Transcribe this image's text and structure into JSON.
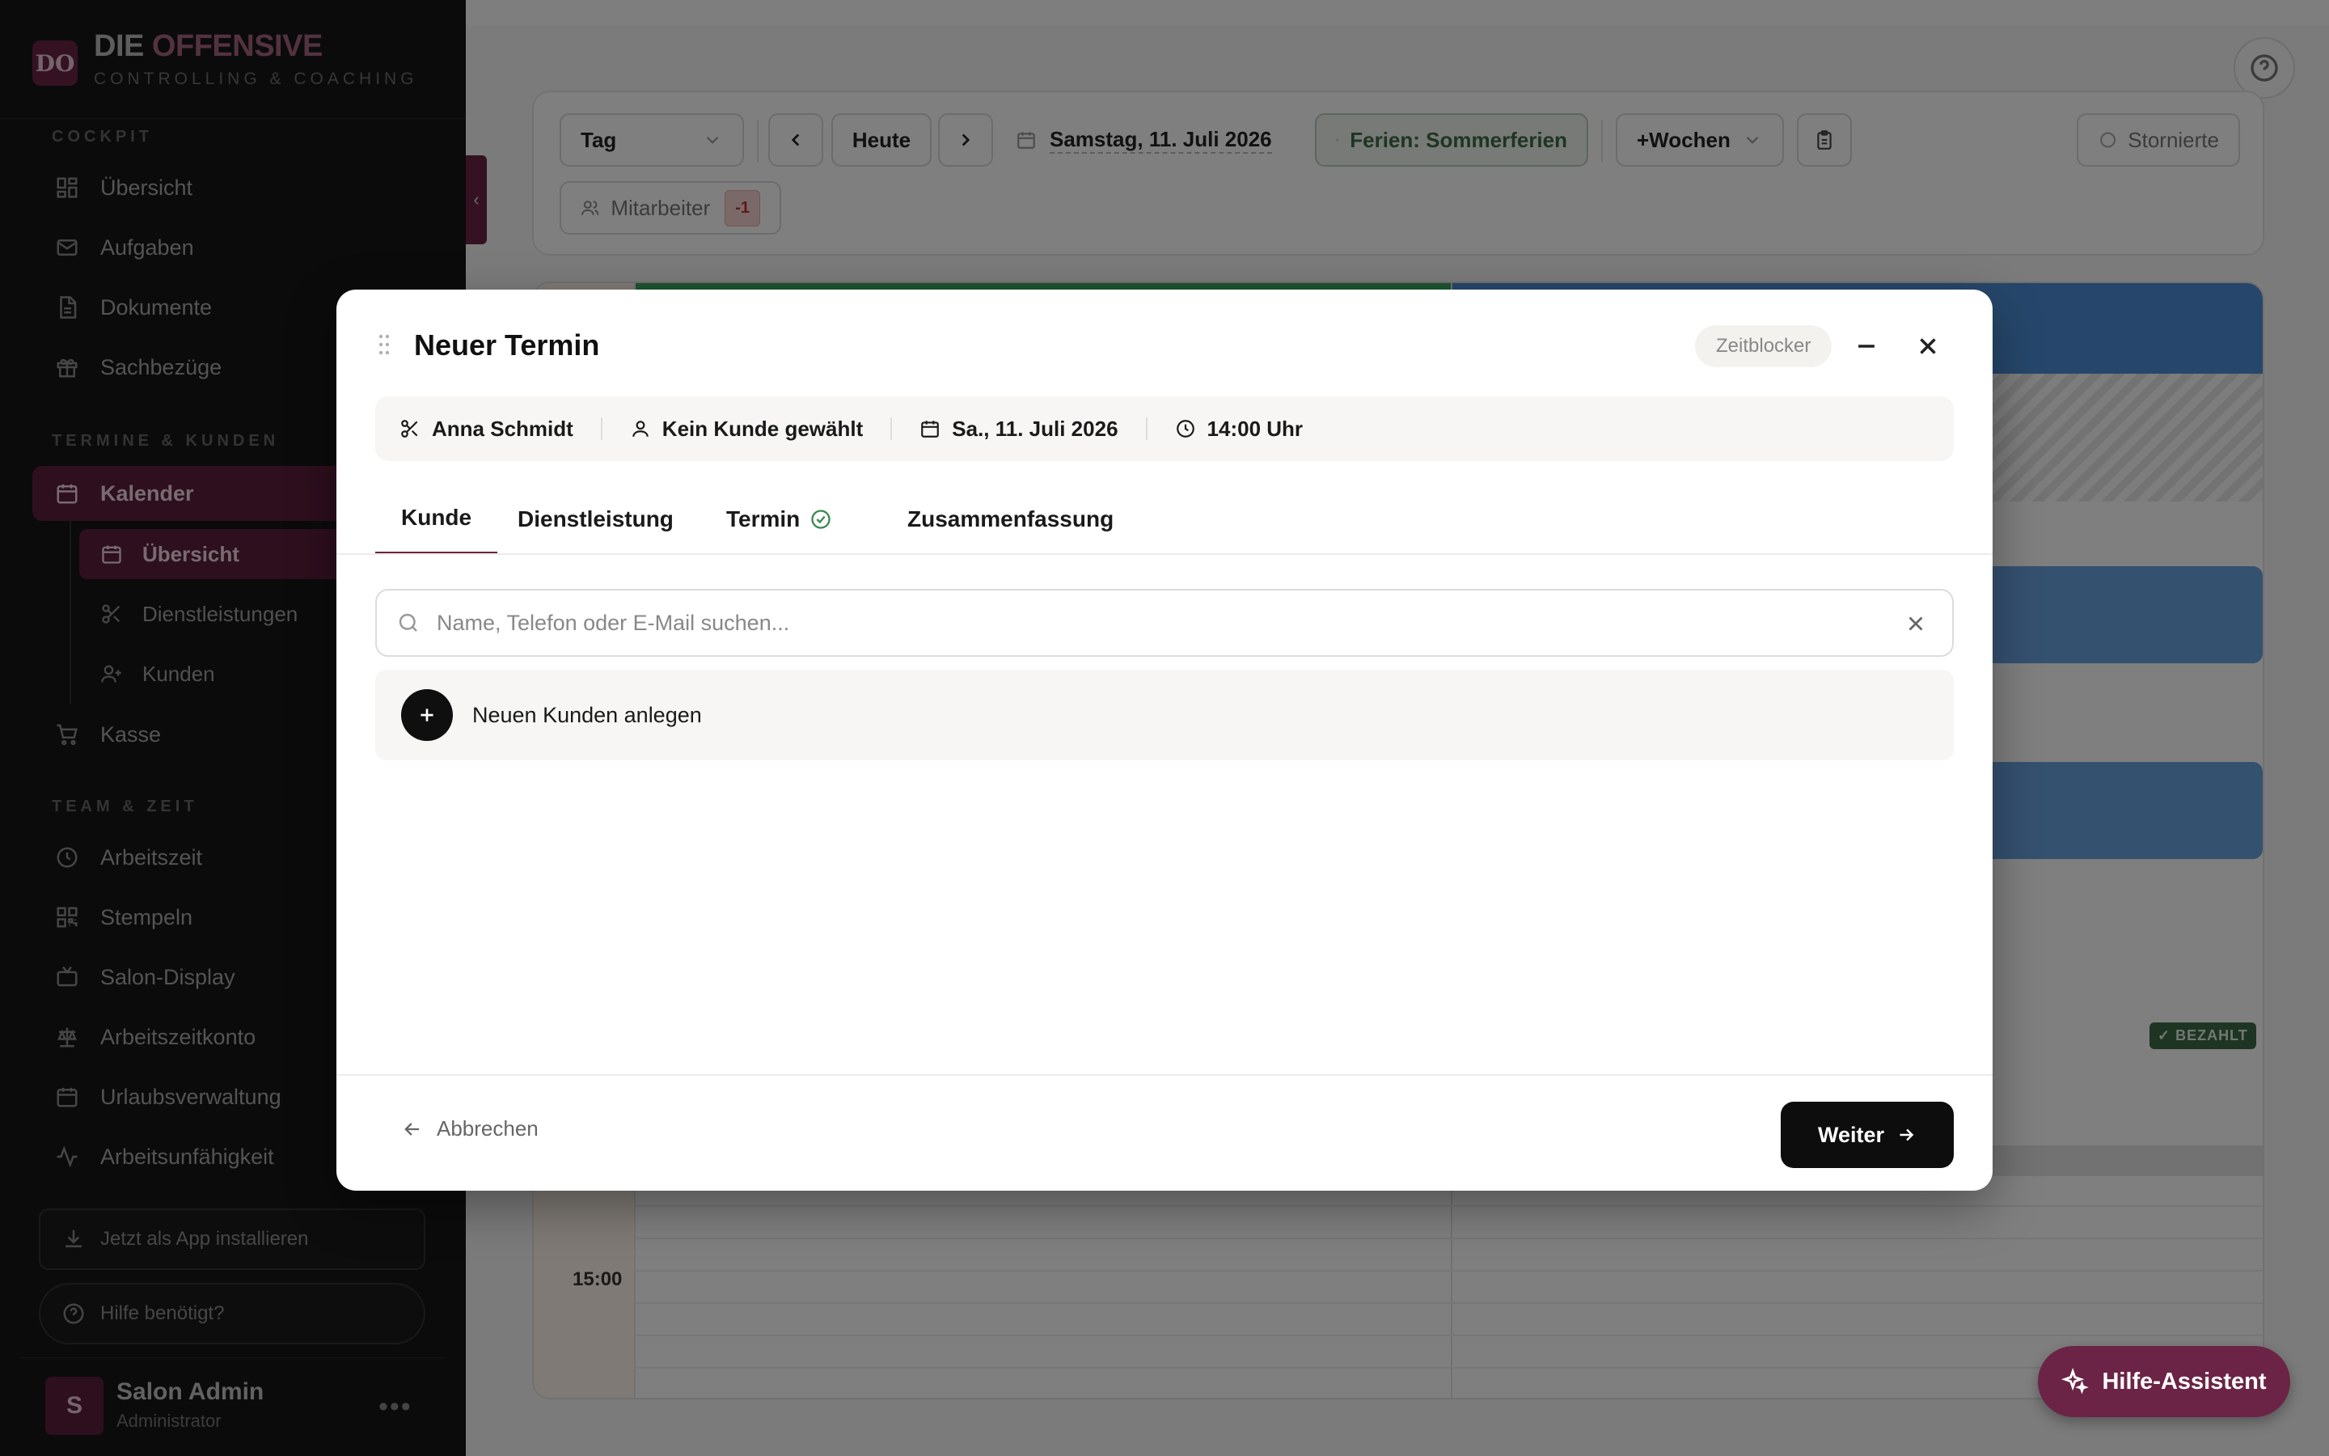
{
  "sidebar": {
    "logo_initials": "DO",
    "brand_part1": "DIE",
    "brand_part2": "OFFENSIVE",
    "brand_sub": "CONTROLLING & COACHING",
    "sections": {
      "cockpit": "COCKPIT",
      "termine": "TERMINE & KUNDEN",
      "team": "TEAM & ZEIT"
    },
    "items": {
      "uebersicht": "Übersicht",
      "aufgaben": "Aufgaben",
      "dokumente": "Dokumente",
      "sachbezuege": "Sachbezüge",
      "kalender": "Kalender",
      "kal_uebersicht": "Übersicht",
      "dienstleistungen": "Dienstleistungen",
      "kunden": "Kunden",
      "kasse": "Kasse",
      "arbeitszeit": "Arbeitszeit",
      "stempeln": "Stempeln",
      "salon_display": "Salon-Display",
      "arbeitszeitkonto": "Arbeitszeitkonto",
      "urlaubsverwaltung": "Urlaubsverwaltung",
      "arbeitsunfaehigkeit": "Arbeitsunfähigkeit"
    },
    "install_app": "Jetzt als App installieren",
    "help": "Hilfe benötigt?",
    "user": {
      "initial": "S",
      "name": "Salon Admin",
      "role": "Administrator",
      "more": "•••"
    }
  },
  "toolbar": {
    "view_select": "Tag",
    "today": "Heute",
    "date": "Samstag, 11. Juli 2026",
    "holiday": "Ferien: Sommerferien",
    "weeks": "+Wochen",
    "cancelled": "Stornierte",
    "staff": "Mitarbeiter",
    "staff_badge": "-1"
  },
  "calendar": {
    "time_label": "15:00",
    "paid_badge": "✓ BEZAHLT"
  },
  "modal": {
    "title": "Neuer Termin",
    "chip": "Zeitblocker",
    "summary": {
      "staff": "Anna Schmidt",
      "customer": "Kein Kunde gewählt",
      "date": "Sa., 11. Juli 2026",
      "time": "14:00 Uhr"
    },
    "tabs": {
      "kunde": "Kunde",
      "dienstleistung": "Dienstleistung",
      "termin": "Termin",
      "zusammenfassung": "Zusammenfassung"
    },
    "search_placeholder": "Name, Telefon oder E-Mail suchen...",
    "search_value": "",
    "new_customer": "Neuen Kunden anlegen",
    "cancel": "Abbrechen",
    "next": "Weiter"
  },
  "fab": {
    "label": "Hilfe-Assistent"
  },
  "colors": {
    "brand": "#6b2445",
    "sidebar_bg": "#161616",
    "ferien_green": "#3f6b46",
    "event_blue": "#6aa3e0"
  }
}
